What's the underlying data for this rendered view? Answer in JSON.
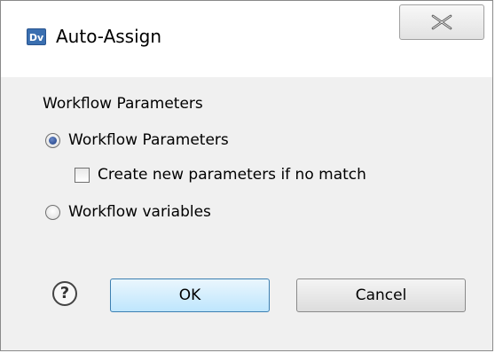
{
  "window": {
    "title": "Auto-Assign",
    "app_icon_text": "Dv"
  },
  "group": {
    "label": "Workflow Parameters"
  },
  "options": {
    "workflow_parameters": {
      "label": "Workflow Parameters",
      "checked": true
    },
    "create_new": {
      "label": "Create new parameters if no match",
      "checked": false
    },
    "workflow_variables": {
      "label": "Workflow variables",
      "checked": false
    }
  },
  "buttons": {
    "help": "?",
    "ok": "OK",
    "cancel": "Cancel"
  },
  "icons": {
    "app": "dv-app-icon",
    "close": "close-icon",
    "help": "help-icon"
  },
  "colors": {
    "ok_border": "#3c7fb1",
    "ok_fill": "#bee6fd",
    "radio_dot": "#1a3c80"
  }
}
